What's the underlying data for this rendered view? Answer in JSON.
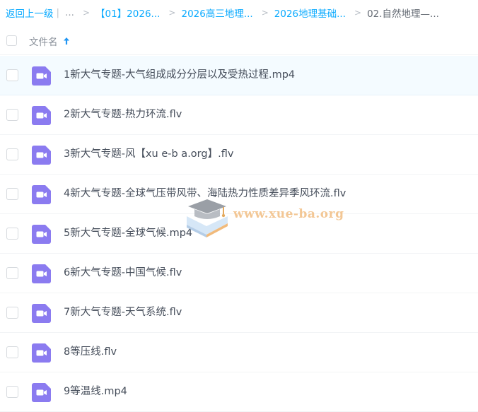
{
  "breadcrumb": {
    "back_label": "返回上一级",
    "separator": "|",
    "ellipsis": "...",
    "arrow": ">",
    "items": [
      {
        "label": "【01】2026..."
      },
      {
        "label": "2026高三地理..."
      },
      {
        "label": "2026地理基础..."
      }
    ],
    "current": "02.自然地理—..."
  },
  "list_header": {
    "name_label": "文件名",
    "sort": "ascending",
    "sort_icon": "arrow-up-icon"
  },
  "file_icon": "video-file-icon",
  "colors": {
    "link": "#09aaff",
    "icon": "#8b7bf0",
    "selected_row": "#f4fbff",
    "text": "#454d5a"
  },
  "files": [
    {
      "name": "1新大气专题-大气组成成分分层以及受热过程.mp4",
      "selected": true
    },
    {
      "name": "2新大气专题-热力环流.flv",
      "selected": false
    },
    {
      "name": "3新大气专题-风【xu e-b a.org】.flv",
      "selected": false
    },
    {
      "name": "4新大气专题-全球气压带风带、海陆热力性质差异季风环流.flv",
      "selected": false
    },
    {
      "name": "5新大气专题-全球气候.mp4",
      "selected": false
    },
    {
      "name": "6新大气专题-中国气候.flv",
      "selected": false
    },
    {
      "name": "7新大气专题-天气系统.flv",
      "selected": false
    },
    {
      "name": "8等压线.flv",
      "selected": false
    },
    {
      "name": "9等温线.mp4",
      "selected": false
    }
  ],
  "watermark": {
    "text": "www.xue-ba.org",
    "icon": "graduation-cap-book-icon"
  }
}
